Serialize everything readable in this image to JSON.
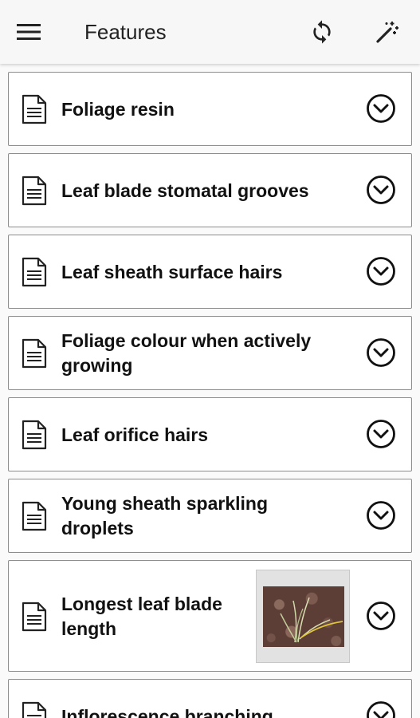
{
  "app_bar": {
    "title": "Features",
    "menu_icon": "hamburger-menu-icon",
    "refresh_icon": "refresh-icon",
    "wand_icon": "magic-wand-icon"
  },
  "features": [
    {
      "label": "Foliage resin"
    },
    {
      "label": "Leaf blade stomatal grooves"
    },
    {
      "label": "Leaf sheath surface hairs"
    },
    {
      "label": "Foliage colour when actively growing"
    },
    {
      "label": "Leaf orifice hairs"
    },
    {
      "label": "Young sheath sparkling droplets"
    },
    {
      "label": "Longest leaf blade length",
      "has_image": true
    },
    {
      "label": "Inflorescence branching"
    }
  ],
  "colors": {
    "card_border": "#8d8d8d",
    "app_bar_bg": "#f7f7f7",
    "page_bg": "#fafafa"
  }
}
